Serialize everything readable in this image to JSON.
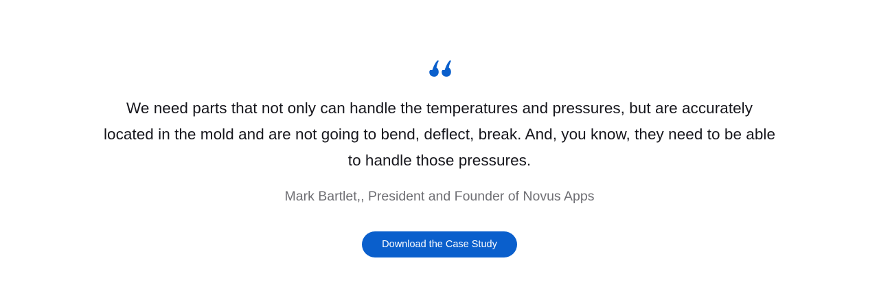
{
  "testimonial": {
    "quote_icon": "left-double-quote-icon",
    "quote": "We need parts that not only can handle the temperatures and pressures, but are accurately located in the mold and are not going to bend, deflect, break. And, you know, they need to be able to handle those pressures.",
    "attribution": "Mark Bartlet,, President and Founder of Novus Apps",
    "cta_label": "Download the Case Study"
  },
  "colors": {
    "accent": "#0a5fcc",
    "text": "#16161c",
    "muted_text": "#6f6f74",
    "background": "#ffffff"
  }
}
